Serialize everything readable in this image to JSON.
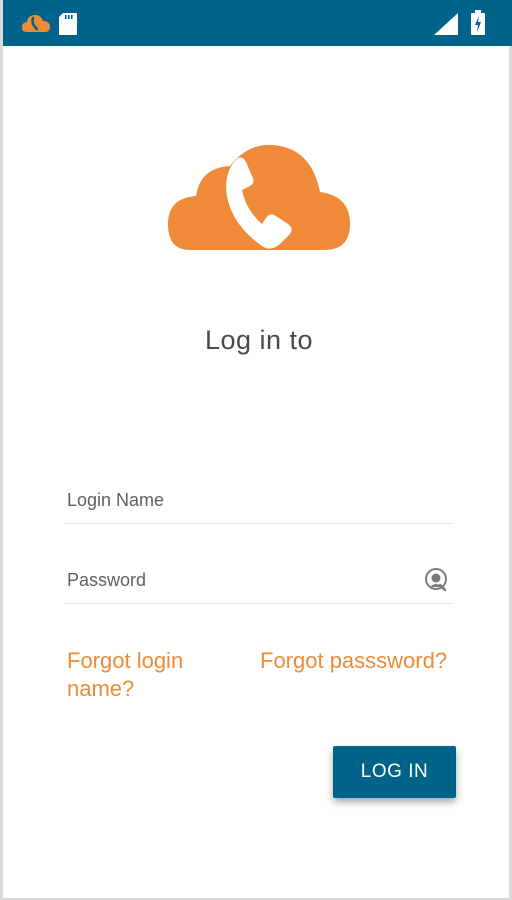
{
  "status_bar": {
    "left_icons": [
      "cloud-phone-notification-icon",
      "sd-card-icon"
    ],
    "right_icons": [
      "signal-icon",
      "battery-charging-icon"
    ]
  },
  "app": {
    "logo": "cloud-phone-logo",
    "title": "Log in to",
    "brand_color": "#ee8a38",
    "primary_color": "#006389"
  },
  "form": {
    "login_name_placeholder": "Login Name",
    "password_placeholder": "Password",
    "forgot_login_label": "Forgot login name?",
    "forgot_password_label": "Forgot passsword?",
    "login_button_label": "LOG IN"
  }
}
